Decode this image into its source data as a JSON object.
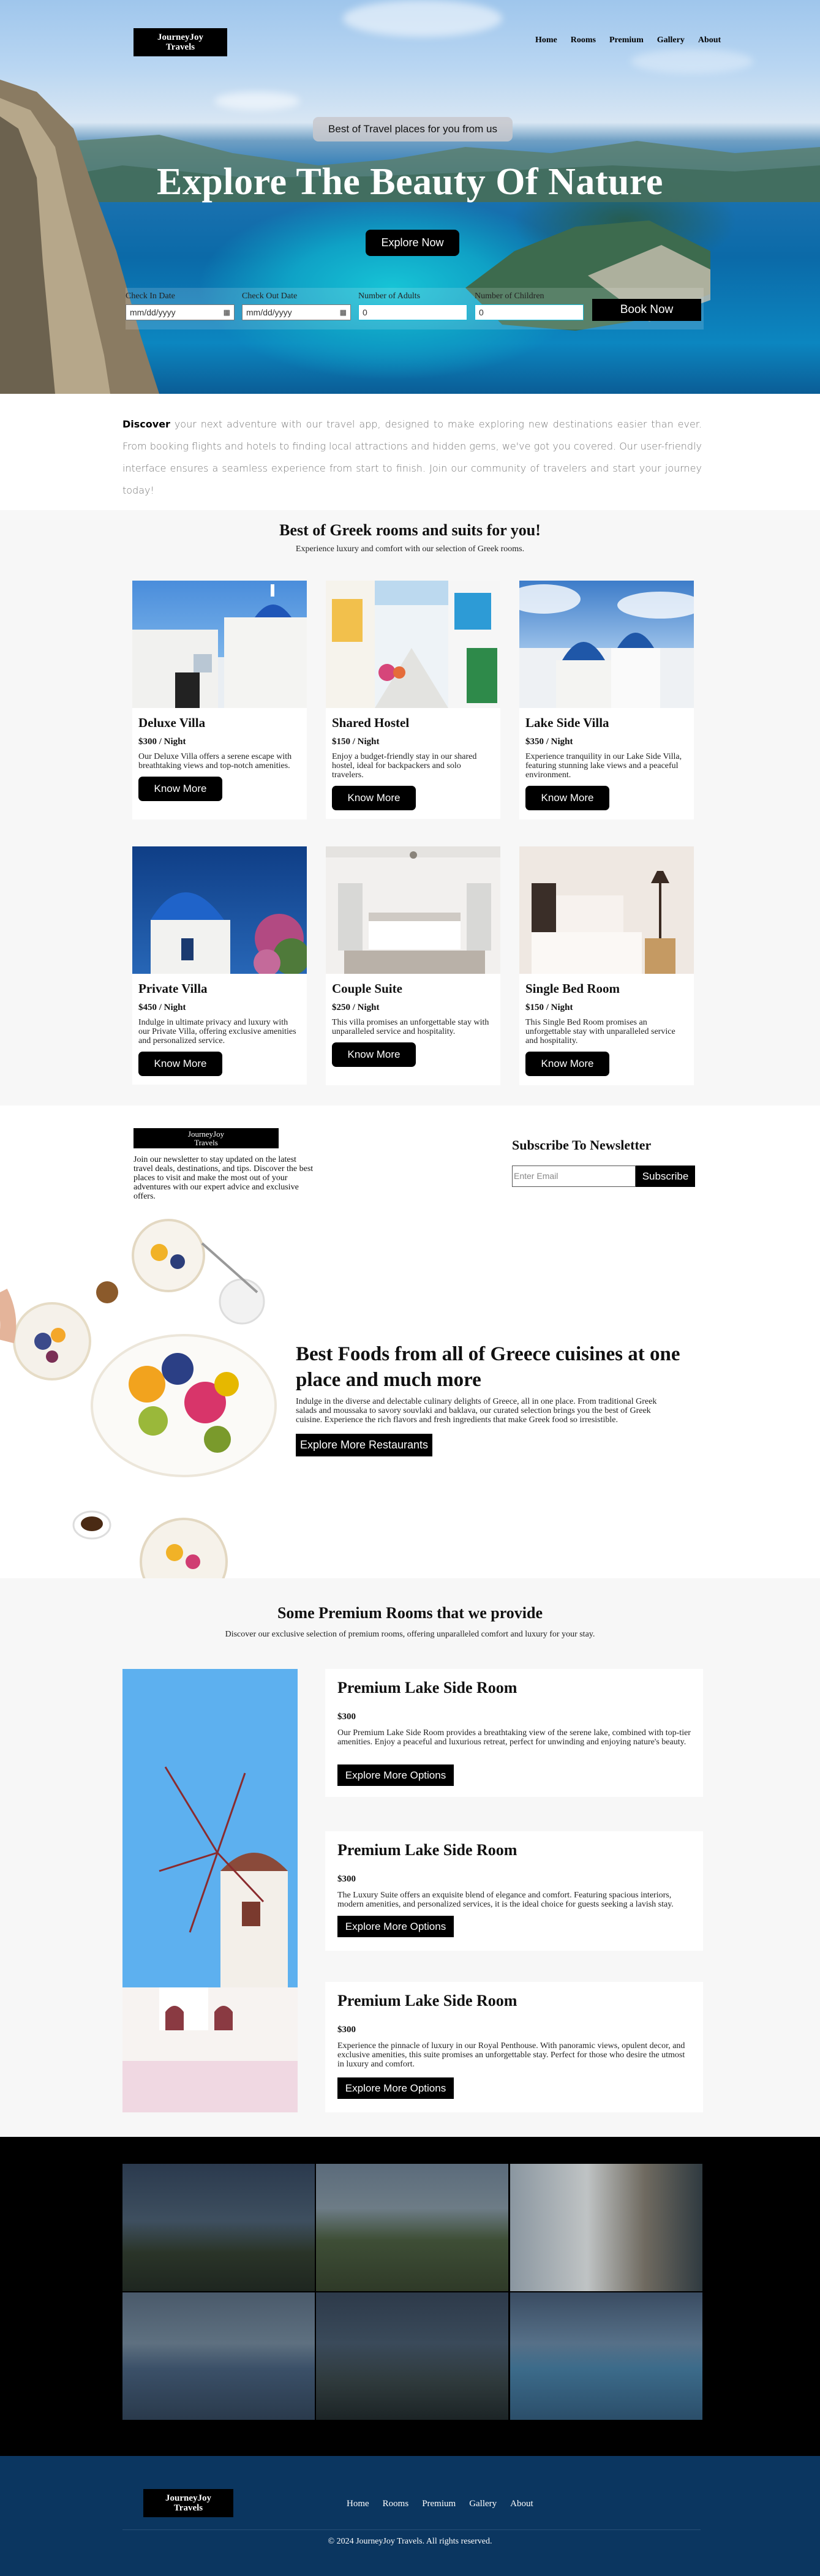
{
  "nav": {
    "logo": [
      "JourneyJoy",
      "Travels"
    ],
    "links": [
      "Home",
      "Rooms",
      "Premium",
      "Gallery",
      "About"
    ]
  },
  "hero": {
    "tagline": "Best of Travel places for you from us",
    "title": "Explore The Beauty Of Nature",
    "cta": "Explore Now"
  },
  "search": {
    "checkin_label": "Check In Date",
    "checkin_value": "mm/dd/yyyy",
    "checkout_label": "Check Out Date",
    "checkout_value": "mm/dd/yyyy",
    "adults_label": "Number of Adults",
    "adults_value": "0",
    "children_label": "Number of Children",
    "children_value": "0",
    "book_label": "Book Now"
  },
  "discover": {
    "lead": "Discover",
    "text": " your next adventure with our travel app, designed to make exploring new destinations easier than ever. From booking flights and hotels to finding local attractions and hidden gems, we've got you covered. Our user-friendly interface ensures a seamless experience from start to finish. Join our community of travelers and start your journey today!"
  },
  "rooms": {
    "title": "Best of Greek rooms and suits for you!",
    "subtitle": "Experience luxury and comfort with our selection of Greek rooms.",
    "button_label": "Know More",
    "cards": [
      {
        "name": "Deluxe Villa",
        "price": "$300 / Night",
        "desc": "Our Deluxe Villa offers a serene escape with breathtaking views and top-notch amenities."
      },
      {
        "name": "Shared Hostel",
        "price": "$150 / Night",
        "desc": "Enjoy a budget-friendly stay in our shared hostel, ideal for backpackers and solo travelers."
      },
      {
        "name": "Lake Side Villa",
        "price": "$350 / Night",
        "desc": "Experience tranquility in our Lake Side Villa, featuring stunning lake views and a peaceful environment."
      },
      {
        "name": "Private Villa",
        "price": "$450 / Night",
        "desc": "Indulge in ultimate privacy and luxury with our Private Villa, offering exclusive amenities and personalized service."
      },
      {
        "name": "Couple Suite",
        "price": "$250 / Night",
        "desc": "This villa promises an unforgettable stay with unparalleled service and hospitality."
      },
      {
        "name": "Single Bed Room",
        "price": "$150 / Night",
        "desc": "This Single Bed Room promises an unforgettable stay with unparalleled service and hospitality."
      }
    ]
  },
  "newsletter": {
    "logo": [
      "JourneyJoy",
      "Travels"
    ],
    "text": "Join our newsletter to stay updated on the latest travel deals, destinations, and tips. Discover the best places to visit and make the most out of your adventures with our expert advice and exclusive offers.",
    "title": "Subscribe To Newsletter",
    "placeholder": "Enter Email",
    "button": "Subscribe"
  },
  "foods": {
    "title": "Best Foods from all of Greece cuisines at one place and much more",
    "text": "Indulge in the diverse and delectable culinary delights of Greece, all in one place. From traditional Greek salads and moussaka to savory souvlaki and baklava, our curated selection brings you the best of Greek cuisine. Experience the rich flavors and fresh ingredients that make Greek food so irresistible.",
    "button": "Explore More Restaurants"
  },
  "premium": {
    "title": "Some Premium Rooms that we provide",
    "subtitle": "Discover our exclusive selection of premium rooms, offering unparalleled comfort and luxury for your stay.",
    "button_label": "Explore More Options",
    "cards": [
      {
        "name": "Premium Lake Side Room",
        "price": "$300",
        "desc": "Our Premium Lake Side Room provides a breathtaking view of the serene lake, combined with top-tier amenities. Enjoy a peaceful and luxurious retreat, perfect for unwinding and enjoying nature's beauty."
      },
      {
        "name": "Premium Lake Side Room",
        "price": "$300",
        "desc": "The Luxury Suite offers an exquisite blend of elegance and comfort. Featuring spacious interiors, modern amenities, and personalized services, it is the ideal choice for guests seeking a lavish stay."
      },
      {
        "name": "Premium Lake Side Room",
        "price": "$300",
        "desc": "Experience the pinnacle of luxury in our Royal Penthouse. With panoramic views, opulent decor, and exclusive amenities, this suite promises an unforgettable stay. Perfect for those who desire the utmost in luxury and comfort."
      }
    ]
  },
  "footer": {
    "logo": [
      "JourneyJoy",
      "Travels"
    ],
    "links": [
      "Home",
      "Rooms",
      "Premium",
      "Gallery",
      "About"
    ],
    "copyright": "© 2024 JourneyJoy Travels. All rights reserved."
  },
  "colors": {
    "primary": "#000000",
    "footer_bg": "#0b3660",
    "section_bg": "#f7f7f7"
  }
}
